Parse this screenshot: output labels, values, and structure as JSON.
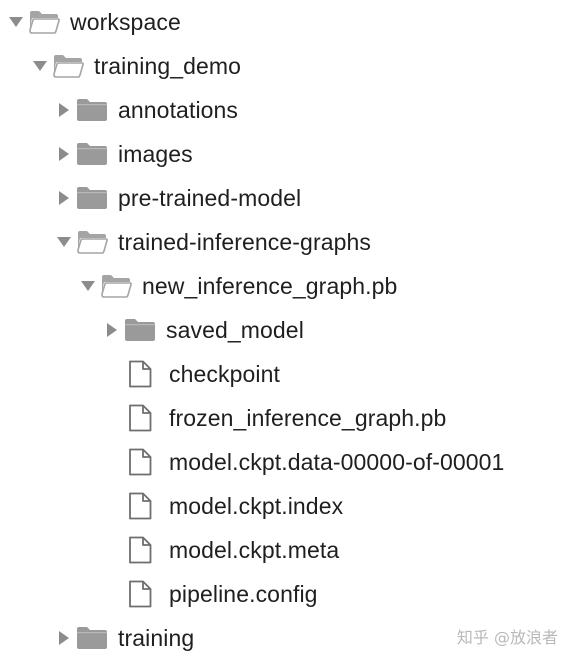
{
  "tree": {
    "items": [
      {
        "label": "workspace",
        "depth": 0,
        "kind": "folder",
        "state": "expanded",
        "icon": "folder-open-icon"
      },
      {
        "label": "training_demo",
        "depth": 1,
        "kind": "folder",
        "state": "expanded",
        "icon": "folder-open-icon"
      },
      {
        "label": "annotations",
        "depth": 2,
        "kind": "folder",
        "state": "collapsed",
        "icon": "folder-icon"
      },
      {
        "label": "images",
        "depth": 2,
        "kind": "folder",
        "state": "collapsed",
        "icon": "folder-icon"
      },
      {
        "label": "pre-trained-model",
        "depth": 2,
        "kind": "folder",
        "state": "collapsed",
        "icon": "folder-icon"
      },
      {
        "label": "trained-inference-graphs",
        "depth": 2,
        "kind": "folder",
        "state": "expanded",
        "icon": "folder-open-icon"
      },
      {
        "label": "new_inference_graph.pb",
        "depth": 3,
        "kind": "folder",
        "state": "expanded",
        "icon": "folder-open-icon"
      },
      {
        "label": "saved_model",
        "depth": 4,
        "kind": "folder",
        "state": "collapsed",
        "icon": "folder-icon"
      },
      {
        "label": "checkpoint",
        "depth": 4,
        "kind": "file",
        "state": "none",
        "icon": "file-icon"
      },
      {
        "label": "frozen_inference_graph.pb",
        "depth": 4,
        "kind": "file",
        "state": "none",
        "icon": "file-icon"
      },
      {
        "label": "model.ckpt.data-00000-of-00001",
        "depth": 4,
        "kind": "file",
        "state": "none",
        "icon": "file-icon"
      },
      {
        "label": "model.ckpt.index",
        "depth": 4,
        "kind": "file",
        "state": "none",
        "icon": "file-icon"
      },
      {
        "label": "model.ckpt.meta",
        "depth": 4,
        "kind": "file",
        "state": "none",
        "icon": "file-icon"
      },
      {
        "label": "pipeline.config",
        "depth": 4,
        "kind": "file",
        "state": "none",
        "icon": "file-icon"
      },
      {
        "label": "training",
        "depth": 2,
        "kind": "folder",
        "state": "collapsed",
        "icon": "folder-icon"
      }
    ]
  },
  "watermark": {
    "text": "知乎 @放浪者"
  },
  "colors": {
    "folder": "#9a9a9a",
    "folder_open": "#a5a5a5",
    "arrow": "#8c8c8c",
    "file_outline": "#6e6e6e",
    "text": "#1f1f1f"
  }
}
